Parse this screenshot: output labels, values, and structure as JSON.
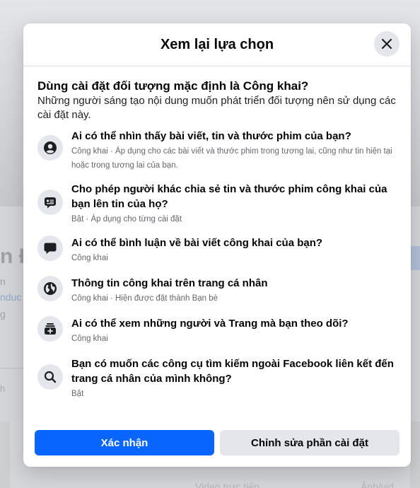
{
  "background": {
    "name_fragment": "n Đ",
    "sub_line_1": "n",
    "sub_line_2": "nduc",
    "sub_line_3": "g",
    "sub_line_4": "h",
    "footer_video": "Video trực tiếp",
    "footer_photo": "Ảnh/vid"
  },
  "dialog": {
    "title": "Xem lại lựa chọn",
    "question_title": "Dùng cài đặt đối tượng mặc định là Công khai?",
    "question_desc": "Những người sáng tạo nội dung muốn phát triển đối tượng nên sử dụng các cài đặt này.",
    "settings": [
      {
        "icon": "person-circle-icon",
        "title": "Ai có thể nhìn thấy bài viết, tin và thước phim của bạn?",
        "subtitle": "Công khai · Áp dụng cho các bài viết và thước phim trong tương lai, cũng như tin hiện tại hoặc trong tương lai của bạn."
      },
      {
        "icon": "share-stories-icon",
        "title": "Cho phép người khác chia sẻ tin và thước phim công khai của bạn lên tin của họ?",
        "subtitle": "Bật · Áp dụng cho từng cài đặt"
      },
      {
        "icon": "comment-icon",
        "title": "Ai có thể bình luận về bài viết công khai của bạn?",
        "subtitle": "Công khai"
      },
      {
        "icon": "globe-icon",
        "title": "Thông tin công khai trên trang cá nhân",
        "subtitle": "Công khai · Hiện được đặt thành Bạn bè"
      },
      {
        "icon": "followers-icon",
        "title": "Ai có thể xem những người và Trang mà bạn theo dõi?",
        "subtitle": "Công khai"
      },
      {
        "icon": "search-icon",
        "title": "Bạn có muốn các công cụ tìm kiếm ngoài Facebook liên kết đến trang cá nhân của mình không?",
        "subtitle": "Bật"
      }
    ],
    "confirm_label": "Xác nhận",
    "edit_label": "Chỉnh sửa phần cài đặt"
  },
  "colors": {
    "primary": "#0866ff",
    "secondary_button": "#e4e6eb",
    "icon_bg": "#e4e6eb"
  }
}
